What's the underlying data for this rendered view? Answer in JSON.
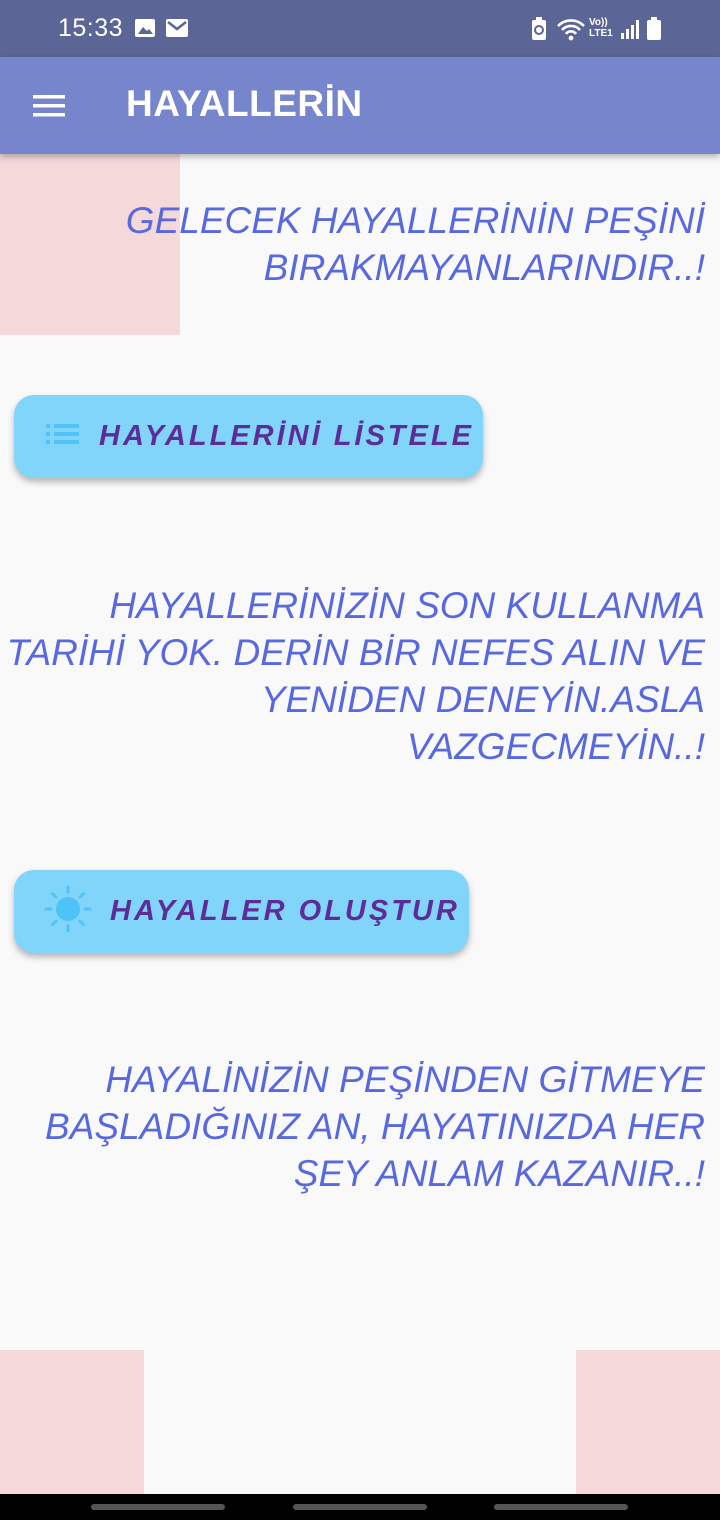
{
  "status_bar": {
    "time": "15:33",
    "left_icons": [
      "image-icon",
      "mail-icon"
    ],
    "right_icons": [
      "battery-saver-icon",
      "wifi-icon",
      "volte-icon",
      "signal-icon",
      "battery-icon"
    ],
    "network_label": "Vo))",
    "network_sublabel": "LTE1"
  },
  "app_bar": {
    "menu_icon": "hamburger-menu-icon",
    "title": "HAYALLERİN",
    "background": "#7786cc"
  },
  "main": {
    "quote_1": {
      "line_1": "GELECEK HAYALLERİNİN PEŞİNİ",
      "line_2": "BIRAKMAYANLARINDIR..!"
    },
    "list_button": {
      "icon": "list-icon",
      "label": "HAYALLERİNİ LİSTELE"
    },
    "quote_2": {
      "line_1": "HAYALLERİNİZİN SON KULLANMA",
      "line_2": "TARİHİ YOK. DERİN BİR NEFES ALIN VE",
      "line_3": "YENİDEN DENEYİN.ASLA",
      "line_4": "VAZGECMEYİN..!"
    },
    "create_button": {
      "icon": "sun-icon",
      "label": "HAYALLER OLUŞTUR"
    },
    "quote_3": {
      "line_1": "HAYALİNİZİN PEŞİNDEN GİTMEYE",
      "line_2": "BAŞLADIĞINIZ AN, HAYATINIZDA HER",
      "line_3": "ŞEY ANLAM KAZANIR..!"
    }
  },
  "colors": {
    "status_bar": "#5b6596",
    "accent_text": "#5868df",
    "button_bg": "#81d4fa",
    "button_text": "#5e2c99",
    "corner_block": "#f5d9d9"
  }
}
